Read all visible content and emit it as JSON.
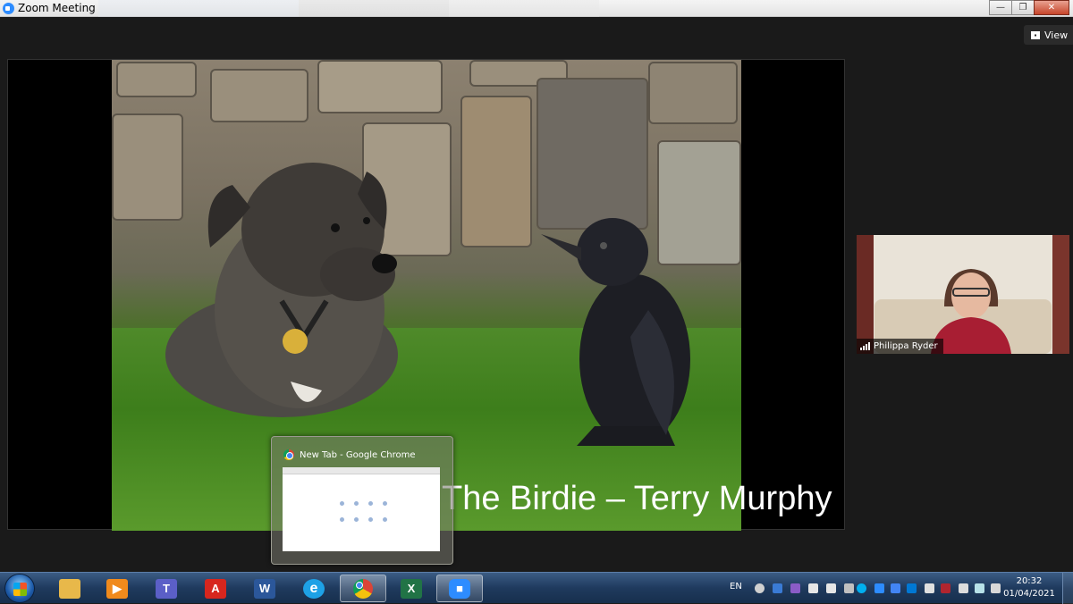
{
  "window": {
    "title": "Zoom Meeting",
    "buttons": {
      "minimize": "—",
      "maximize": "❐",
      "close": "✕"
    }
  },
  "toolbar": {
    "view_label": "View"
  },
  "share": {
    "caption": "The Birdie – Terry Murphy"
  },
  "participant": {
    "name": "Philippa Ryder"
  },
  "taskbar_preview": {
    "title": "New Tab - Google Chrome"
  },
  "taskbar": {
    "apps": [
      {
        "name": "file-explorer",
        "icon": "folder-icon",
        "color": "#e8b84a"
      },
      {
        "name": "media-player",
        "icon": "play-icon",
        "color": "#f08a1c"
      },
      {
        "name": "microsoft-teams",
        "icon": "teams-icon",
        "color": "#5b5fc7",
        "glyph": "T"
      },
      {
        "name": "adobe-reader",
        "icon": "pdf-icon",
        "color": "#d7261e",
        "glyph": "A"
      },
      {
        "name": "microsoft-word",
        "icon": "word-icon",
        "color": "#2b579a",
        "glyph": "W"
      },
      {
        "name": "internet-explorer",
        "icon": "ie-icon",
        "color": "#1ea1e6",
        "glyph": "e"
      },
      {
        "name": "google-chrome",
        "icon": "chrome-icon",
        "color": "#db4437",
        "active": true
      },
      {
        "name": "microsoft-excel",
        "icon": "excel-icon",
        "color": "#217346",
        "glyph": "X"
      },
      {
        "name": "zoom",
        "icon": "zoom-icon",
        "color": "#2d8cff",
        "active": true
      }
    ],
    "language": "EN",
    "clock": {
      "time": "20:32",
      "date": "01/04/2021"
    }
  },
  "colors": {
    "taskbar": "#1f3a5e",
    "meeting_bg": "#1a1a1a",
    "zoom_blue": "#2d8cff"
  }
}
